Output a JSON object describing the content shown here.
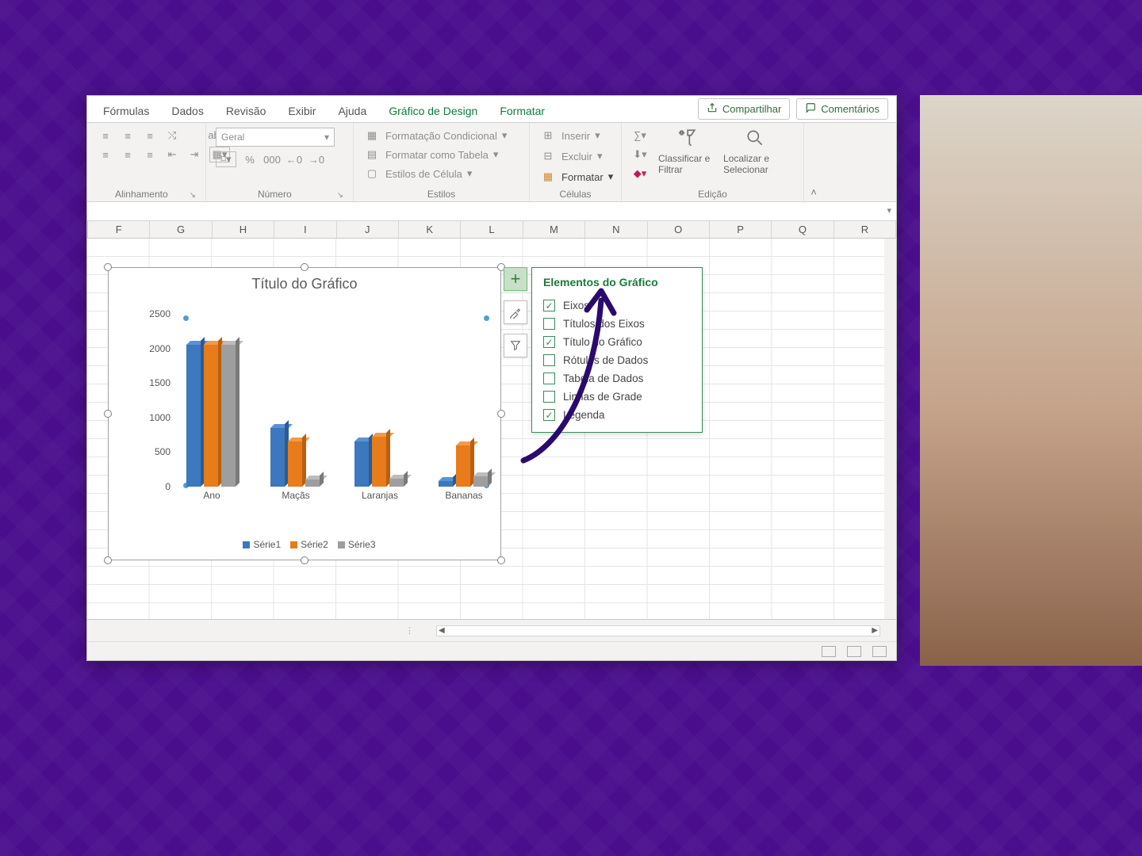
{
  "ribbon": {
    "tabs": [
      "Fórmulas",
      "Dados",
      "Revisão",
      "Exibir",
      "Ajuda"
    ],
    "context_tabs": [
      "Gráfico de Design",
      "Formatar"
    ],
    "share": "Compartilhar",
    "comments": "Comentários",
    "groups": {
      "alignment": {
        "label": "Alinhamento"
      },
      "number": {
        "label": "Número",
        "format": "Geral",
        "percent": "%",
        "thousand": "000",
        "inc": ",00",
        "dec": ",00"
      },
      "styles": {
        "label": "Estilos",
        "cond": "Formatação Condicional",
        "table": "Formatar como Tabela",
        "cell": "Estilos de Célula"
      },
      "cells": {
        "label": "Células",
        "insert": "Inserir",
        "delete": "Excluir",
        "format": "Formatar"
      },
      "editing": {
        "label": "Edição",
        "sort": "Classificar e Filtrar",
        "find": "Localizar e Selecionar"
      }
    }
  },
  "columns": [
    "F",
    "G",
    "H",
    "I",
    "J",
    "K",
    "L",
    "M",
    "N",
    "O",
    "P",
    "Q",
    "R"
  ],
  "chart_title": "Título do Gráfico",
  "chart_elements": {
    "header": "Elementos do Gráfico",
    "items": [
      {
        "label": "Eixos",
        "checked": true
      },
      {
        "label": "Títulos dos Eixos",
        "checked": false
      },
      {
        "label": "Título do Gráfico",
        "checked": true
      },
      {
        "label": "Rótulos de Dados",
        "checked": false
      },
      {
        "label": "Tabela de Dados",
        "checked": false
      },
      {
        "label": "Linhas de Grade",
        "checked": false
      },
      {
        "label": "Legenda",
        "checked": true
      }
    ]
  },
  "chart_data": {
    "type": "bar",
    "title": "Título do Gráfico",
    "categories": [
      "Ano",
      "Maçãs",
      "Laranjas",
      "Bananas"
    ],
    "series": [
      {
        "name": "Série1",
        "values": [
          2050,
          850,
          650,
          80
        ]
      },
      {
        "name": "Série2",
        "values": [
          2050,
          650,
          720,
          600
        ]
      },
      {
        "name": "Série3",
        "values": [
          2050,
          100,
          120,
          150
        ]
      }
    ],
    "xlabel": "",
    "ylabel": "",
    "ylim": [
      0,
      2500
    ],
    "yticks": [
      0,
      500,
      1000,
      1500,
      2000,
      2500
    ],
    "legend_position": "bottom"
  }
}
